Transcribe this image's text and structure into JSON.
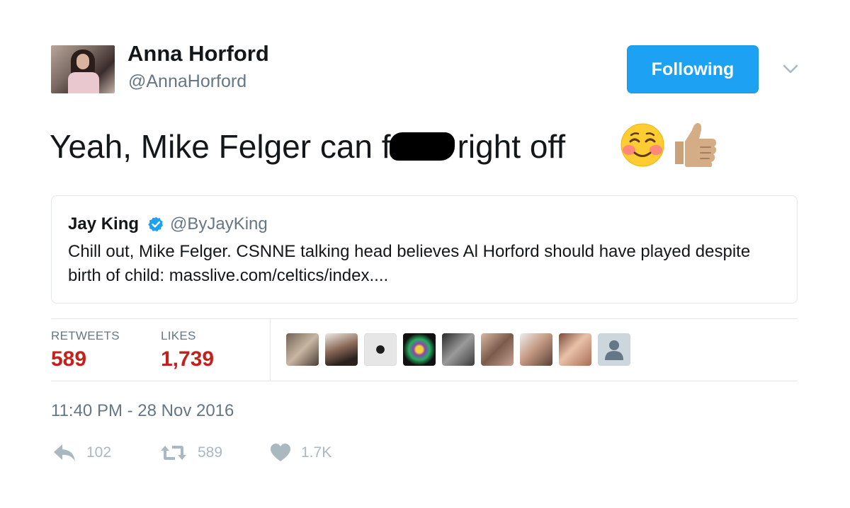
{
  "author": {
    "display_name": "Anna Horford",
    "handle": "@AnnaHorford"
  },
  "follow_button": {
    "label": "Following",
    "color": "#1da1f2"
  },
  "menu": {
    "icon": "chevron-down-icon"
  },
  "tweet": {
    "text_before": "Yeah, Mike Felger can f",
    "text_after": "right off",
    "emojis": [
      "smiling-face-with-blush-icon",
      "thumbs-up-icon"
    ]
  },
  "quoted_tweet": {
    "display_name": "Jay King",
    "verified": true,
    "handle": "@ByJayKing",
    "text": "Chill out, Mike Felger. CSNNE talking head believes Al Horford should have played despite birth of child: masslive.com/celtics/index...."
  },
  "stats": {
    "retweets_label": "RETWEETS",
    "retweets_value": "589",
    "likes_label": "LIKES",
    "likes_value": "1,739",
    "value_color": "#c5211c",
    "liker_avatar_count": 9
  },
  "timestamp": "11:40 PM - 28 Nov 2016",
  "actions": {
    "reply": {
      "icon": "reply-icon",
      "count": "102"
    },
    "retweet": {
      "icon": "retweet-icon",
      "count": "589"
    },
    "like": {
      "icon": "heart-icon",
      "count": "1.7K"
    }
  }
}
